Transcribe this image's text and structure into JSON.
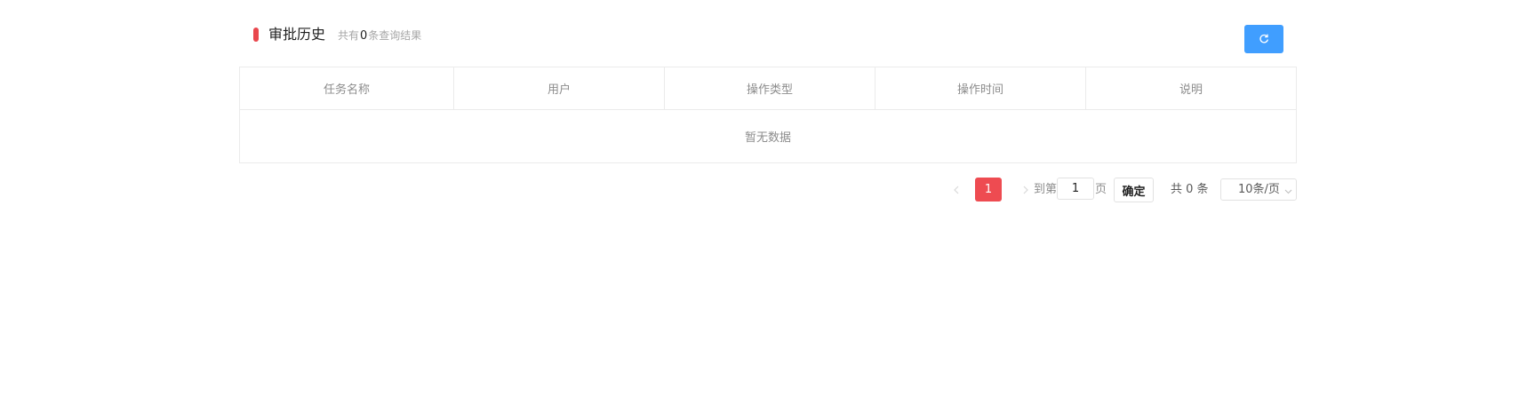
{
  "header": {
    "title": "审批历史",
    "count_prefix": "共有",
    "count_value": "0",
    "count_suffix": "条查询结果",
    "accent_color": "#e9474d",
    "refresh_icon": "refresh-icon",
    "refresh_button_color": "#409eff"
  },
  "table": {
    "columns": [
      "任务名称",
      "用户",
      "操作类型",
      "操作时间",
      "说明"
    ],
    "rows": [],
    "empty_text": "暂无数据"
  },
  "pagination": {
    "prev_icon": "chevron-left-icon",
    "current_page": "1",
    "next_icon": "chevron-right-icon",
    "goto_label": "到第",
    "goto_value": "1",
    "page_label": "页",
    "confirm_label": "确定",
    "total_text": "共 0 条",
    "page_size": "10条/页",
    "page_size_icon": "chevron-down-icon",
    "active_color": "#ee4b51"
  }
}
